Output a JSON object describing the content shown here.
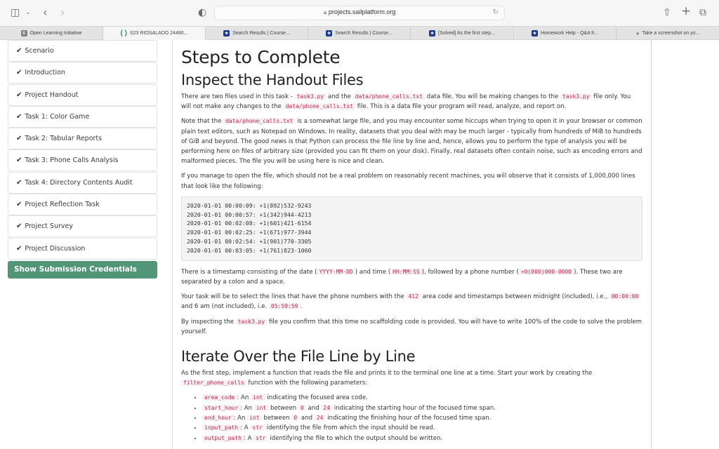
{
  "browser": {
    "url": "projects.sailplatform.org",
    "tabs": [
      {
        "label": "Open Learning Initiative",
        "icon": "s-badge-icon"
      },
      {
        "label": "S23 RIOSALADO 24480...",
        "icon": "parenthesis-icon",
        "active": true
      },
      {
        "label": "Search Results | Course...",
        "icon": "coursehero-icon"
      },
      {
        "label": "Search Results | Course...",
        "icon": "coursehero-icon"
      },
      {
        "label": "[Solved] As the first step...",
        "icon": "coursehero-icon"
      },
      {
        "label": "Homework Help - Q&A fr...",
        "icon": "coursehero-icon"
      },
      {
        "label": "Take a screenshot on yo...",
        "icon": "apple-icon"
      }
    ]
  },
  "sidebar": {
    "items": [
      {
        "label": "Scenario"
      },
      {
        "label": "Introduction"
      },
      {
        "label": "Project Handout"
      },
      {
        "label": "Task 1: Color Game"
      },
      {
        "label": "Task 2: Tabular Reports"
      },
      {
        "label": "Task 3: Phone Calls Analysis"
      },
      {
        "label": "Task 4: Directory Contents Audit"
      },
      {
        "label": "Project Reflection Task"
      },
      {
        "label": "Project Survey"
      },
      {
        "label": "Project Discussion"
      }
    ],
    "credentials_button": "Show Submission Credentials",
    "accent": "#529678"
  },
  "content": {
    "title": "Steps to Complete",
    "section1": {
      "heading": "Inspect the Handout Files",
      "p1": {
        "a": "There are two files used in this task - ",
        "c1": "task3.py",
        "b": " and the ",
        "c2": "data/phone_calls.txt",
        "d": " data file. You will be making changes to the ",
        "c3": "task3.py",
        "e": " file only. You will not make any changes to the ",
        "c4": "data/phone_calls.txt",
        "f": " file. This is a data file your program will read, analyze, and report on."
      },
      "p2": {
        "a": "Note that the ",
        "c1": "data/phone_calls.txt",
        "b": " is a somewhat large file, and you may encounter some hiccups when trying to open it in your browser or common plain text editors, such as Notepad on Windows. In reality, datasets that you deal with may be much larger - typically from hundreds of MiB to hundreds of GiB and beyond. The good news is that Python can process the file line by line and, hence, allows you to perform the type of analysis you will be performing here on files of arbitrary size (provided you can fit them on your disk). Finally, real datasets often contain noise, such as encoding errors and malformed pieces. The file you will be using here is nice and clean."
      },
      "p3": "If you manage to open the file, which should not be a real problem on reasonably recent machines, you will observe that it consists of 1,000,000 lines that look like the following:",
      "code_lines": [
        "2020-01-01 00:00:09: +1(892)532-9243",
        "2020-01-01 00:00:57: +1(342)944-4213",
        "2020-01-01 00:02:08: +1(601)421-6154",
        "2020-01-01 00:02:25: +1(671)977-3944",
        "2020-01-01 00:02:54: +1(901)770-3305",
        "2020-01-01 00:03:05: +1(761)823-1060"
      ],
      "p4": {
        "a": "There is a timestamp consisting of the date (",
        "c1": "YYYY-MM-DD",
        "b": ") and time (",
        "c2": "HH:MM:SS",
        "c": "), followed by a phone number (",
        "c3": "+0(000)000-0000",
        "d": "). These two are separated by a colon and a space."
      },
      "p5": {
        "a": "Your task will be to select the lines that have the phone numbers with the ",
        "c1": "412",
        "b": " area code and timestamps between midnight (included), i.e., ",
        "c2": "00:00:00",
        "c": " and 6 am (not included), i.e. ",
        "c3": "05:59:59",
        "d": "."
      },
      "p6": {
        "a": "By inspecting the ",
        "c1": "task3.py",
        "b": " file you confirm that this time no scaffolding code is provided. You will have to write 100% of the code to solve the problem yourself."
      }
    },
    "section2": {
      "heading": "Iterate Over the File Line by Line",
      "p1": {
        "a": "As the first step, implement a function that reads the file and prints it to the terminal one line at a time. Start your work by creating the ",
        "c1": "filter_phone_calls",
        "b": " function with the following parameters:"
      },
      "params": [
        {
          "name": "area_code",
          "a": ": An ",
          "type": "int",
          "b": " indicating the focused area code."
        },
        {
          "name": "start_hour",
          "a": ": An ",
          "type": "int",
          "b": " between ",
          "lo": "0",
          "c": " and ",
          "hi": "24",
          "d": " indicating the starting hour of the focused time span."
        },
        {
          "name": "end_hour",
          "a": ": An ",
          "type": "int",
          "b": " between ",
          "lo": "0",
          "c": " and ",
          "hi": "24",
          "d": " indicating the finishing hour of the focused time span."
        },
        {
          "name": "input_path",
          "a": ": A ",
          "type": "str",
          "b": " identifying the file from which the input should be read."
        },
        {
          "name": "output_path",
          "a": ": A ",
          "type": "str",
          "b": " identifying the file to which the output should be written."
        }
      ]
    }
  }
}
